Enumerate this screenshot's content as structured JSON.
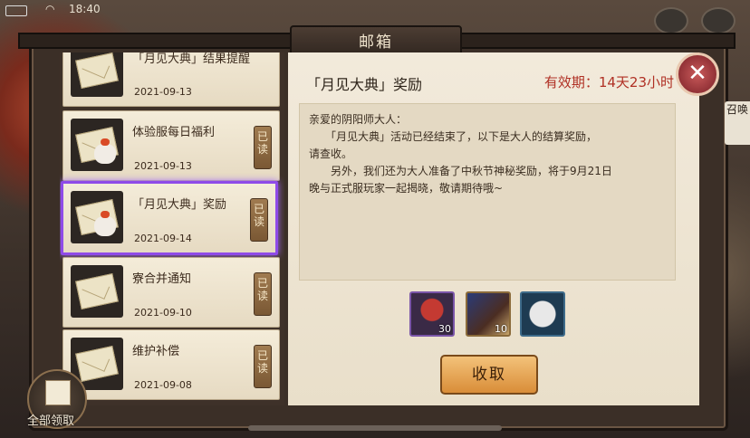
{
  "status": {
    "time": "18:40"
  },
  "window": {
    "title": "邮箱"
  },
  "mails": [
    {
      "title": "「月见大典」结果提醒",
      "date": "2021-09-13",
      "read_label": "",
      "selected": false
    },
    {
      "title": "体验服每日福利",
      "date": "2021-09-13",
      "read_label": "已读",
      "selected": false
    },
    {
      "title": "「月见大典」奖励",
      "date": "2021-09-14",
      "read_label": "已读",
      "selected": true
    },
    {
      "title": "寮合并通知",
      "date": "2021-09-10",
      "read_label": "已读",
      "selected": false
    },
    {
      "title": "维护补偿",
      "date": "2021-09-08",
      "read_label": "已读",
      "selected": false
    }
  ],
  "detail": {
    "subject": "「月见大典」奖励",
    "expiry": "有效期：14天23小时",
    "body": "亲爱的阴阳师大人：\n　　「月见大典」活动已经结束了，以下是大人的结算奖励，\n请查收。\n　　另外，我们还为大人准备了中秋节神秘奖励，将于9月21日\n晚与正式服玩家一起揭晓，敬请期待哦~",
    "rewards": [
      {
        "icon": "red-bird-item-icon",
        "count": "30"
      },
      {
        "icon": "scroll-book-item-icon",
        "count": "10"
      },
      {
        "icon": "daruma-material-icon",
        "count": ""
      }
    ],
    "claim_label": "收取"
  },
  "collect_all_label": "全部领取",
  "side_tab_label": "召唤"
}
